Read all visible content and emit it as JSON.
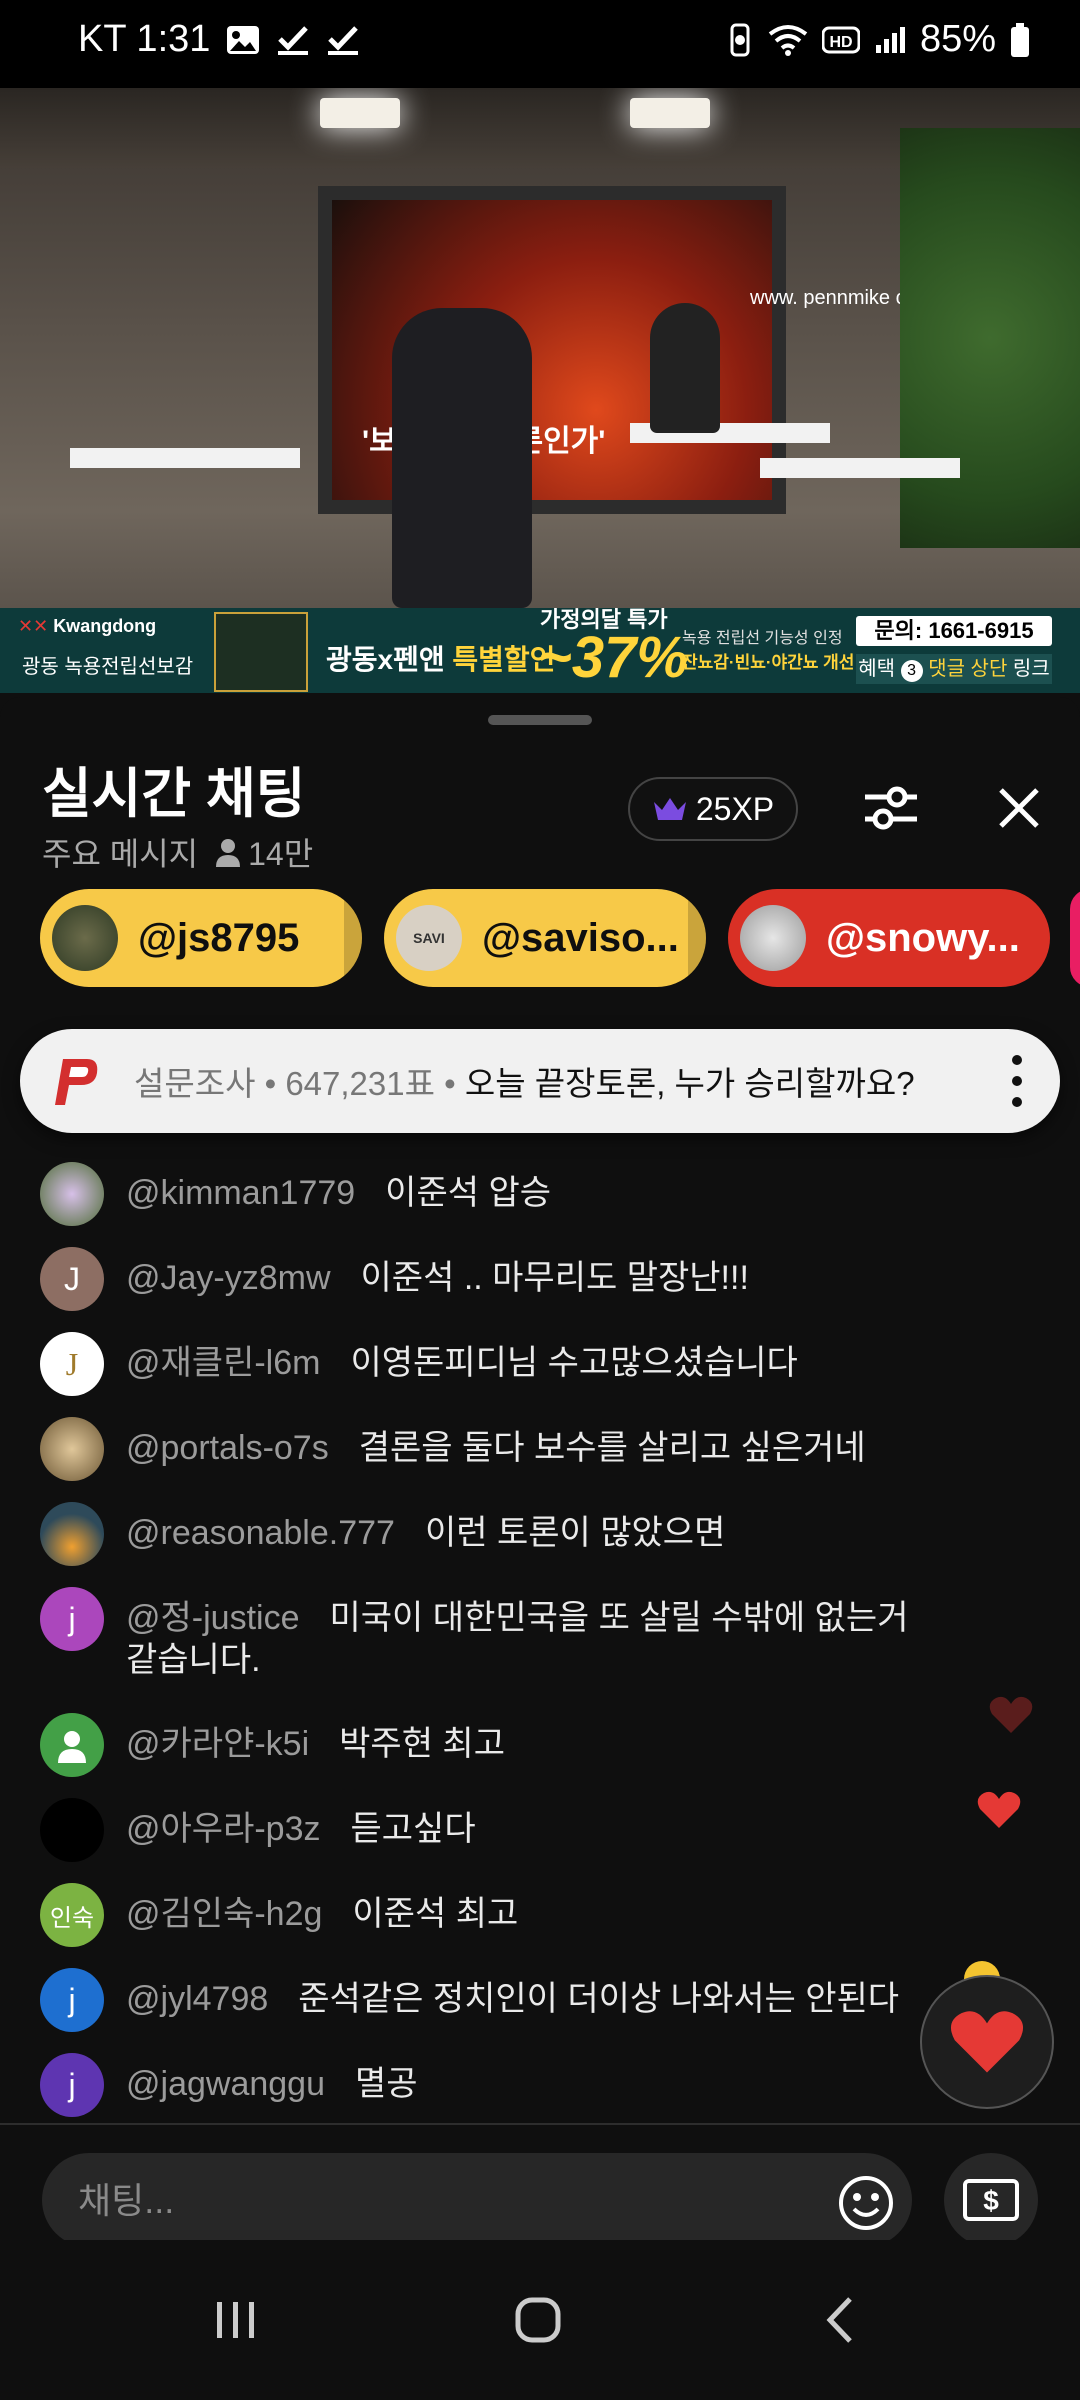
{
  "status_bar": {
    "carrier_time": "KT 1:31",
    "battery": "85%",
    "icons": [
      "gallery-icon",
      "check-icon",
      "check-icon",
      "vibrate-icon",
      "wifi-icon",
      "hd-icon",
      "signal-icon",
      "battery-icon"
    ]
  },
  "video": {
    "screen_caption": "'보수의 오모론인가'",
    "website": "www. pennmike com",
    "ad": {
      "brand": "Kwangdong",
      "product": "광동 녹용전립선보감",
      "offer_prefix": "광동x펜앤",
      "offer_highlight": "특별할인",
      "special": "가정의달 특가",
      "percent": "~37%",
      "note1": "녹용 전립선 기능성 인정",
      "note2": "잔뇨감·빈뇨·야간뇨 개선!",
      "phone": "문의: 1661-6915",
      "link_prefix": "혜택",
      "link_number": "3",
      "link_highlight": "댓글 상단",
      "link_suffix": "링크"
    }
  },
  "chat": {
    "title": "실시간 채팅",
    "mode": "주요 메시지",
    "viewers": "14만",
    "xp": "25XP",
    "pinned_supporters": [
      {
        "label": "@js8795",
        "color": "#f7c948"
      },
      {
        "label": "@saviso...",
        "color": "#f7c948"
      },
      {
        "label": "@snowy...",
        "color": "#d93025"
      }
    ],
    "poll": {
      "meta": "설문조사 • 647,231표 • ",
      "question": "오늘 끝장토론, 누가 승리할까요?"
    },
    "messages": [
      {
        "author": "@kimman1779",
        "text": "이준석 압승",
        "avatar_color": "#6b7f4a",
        "initial": ""
      },
      {
        "author": "@Jay-yz8mw",
        "text": "이준석 .. 마무리도 말장난!!!",
        "avatar_color": "#8d6e63",
        "initial": "J"
      },
      {
        "author": "@재클린-l6m",
        "text": "이영돈피디님 수고많으셨습니다",
        "avatar_color": "#ffffff",
        "initial": "J"
      },
      {
        "author": "@portals-o7s",
        "text": "결론을 둘다 보수를 살리고 싶은거네",
        "avatar_color": "#a58a5c",
        "initial": ""
      },
      {
        "author": "@reasonable.777",
        "text": "이런 토론이 많았으면",
        "avatar_color": "#4a6b5a",
        "initial": ""
      },
      {
        "author": "@정-justice",
        "text": "미국이 대한민국을 또 살릴 수밖에 없는거 같습니다.",
        "avatar_color": "#ab47bc",
        "initial": "j"
      },
      {
        "author": "@카라얀-k5i",
        "text": "박주현 최고",
        "avatar_color": "#43a047",
        "initial": ""
      },
      {
        "author": "@아우라-p3z",
        "text": "듣고싶다",
        "avatar_color": "#000000",
        "initial": ""
      },
      {
        "author": "@김인숙-h2g",
        "text": "이준석 최고",
        "avatar_color": "#7cb342",
        "initial": "인숙"
      },
      {
        "author": "@jyl4798",
        "text": "준석같은 정치인이 더이상 나와서는 안된다",
        "avatar_color": "#1e6fd0",
        "initial": "j"
      },
      {
        "author": "@jagwanggu",
        "text": "멸공",
        "avatar_color": "#5e35b1",
        "initial": "j"
      }
    ],
    "input_placeholder": "채팅..."
  },
  "colors": {
    "background": "#0f0f0f",
    "accent_yellow": "#f7c948",
    "accent_red": "#d93025",
    "heart": "#e53935"
  }
}
